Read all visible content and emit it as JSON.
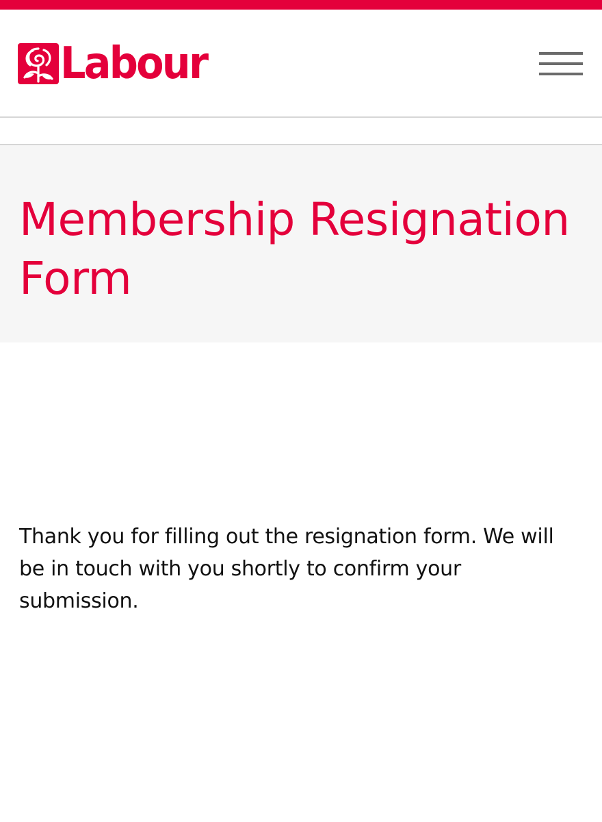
{
  "brand": {
    "name": "Labour",
    "accent_color": "#e4003b",
    "logo_icon": "rose-icon"
  },
  "header": {
    "menu_icon": "hamburger-menu-icon"
  },
  "hero": {
    "title": "Membership Resignation Form",
    "background_color": "#f6f6f6"
  },
  "main": {
    "message": "Thank you for filling out the resignation form. We will be in touch with you shortly to confirm your submission."
  }
}
